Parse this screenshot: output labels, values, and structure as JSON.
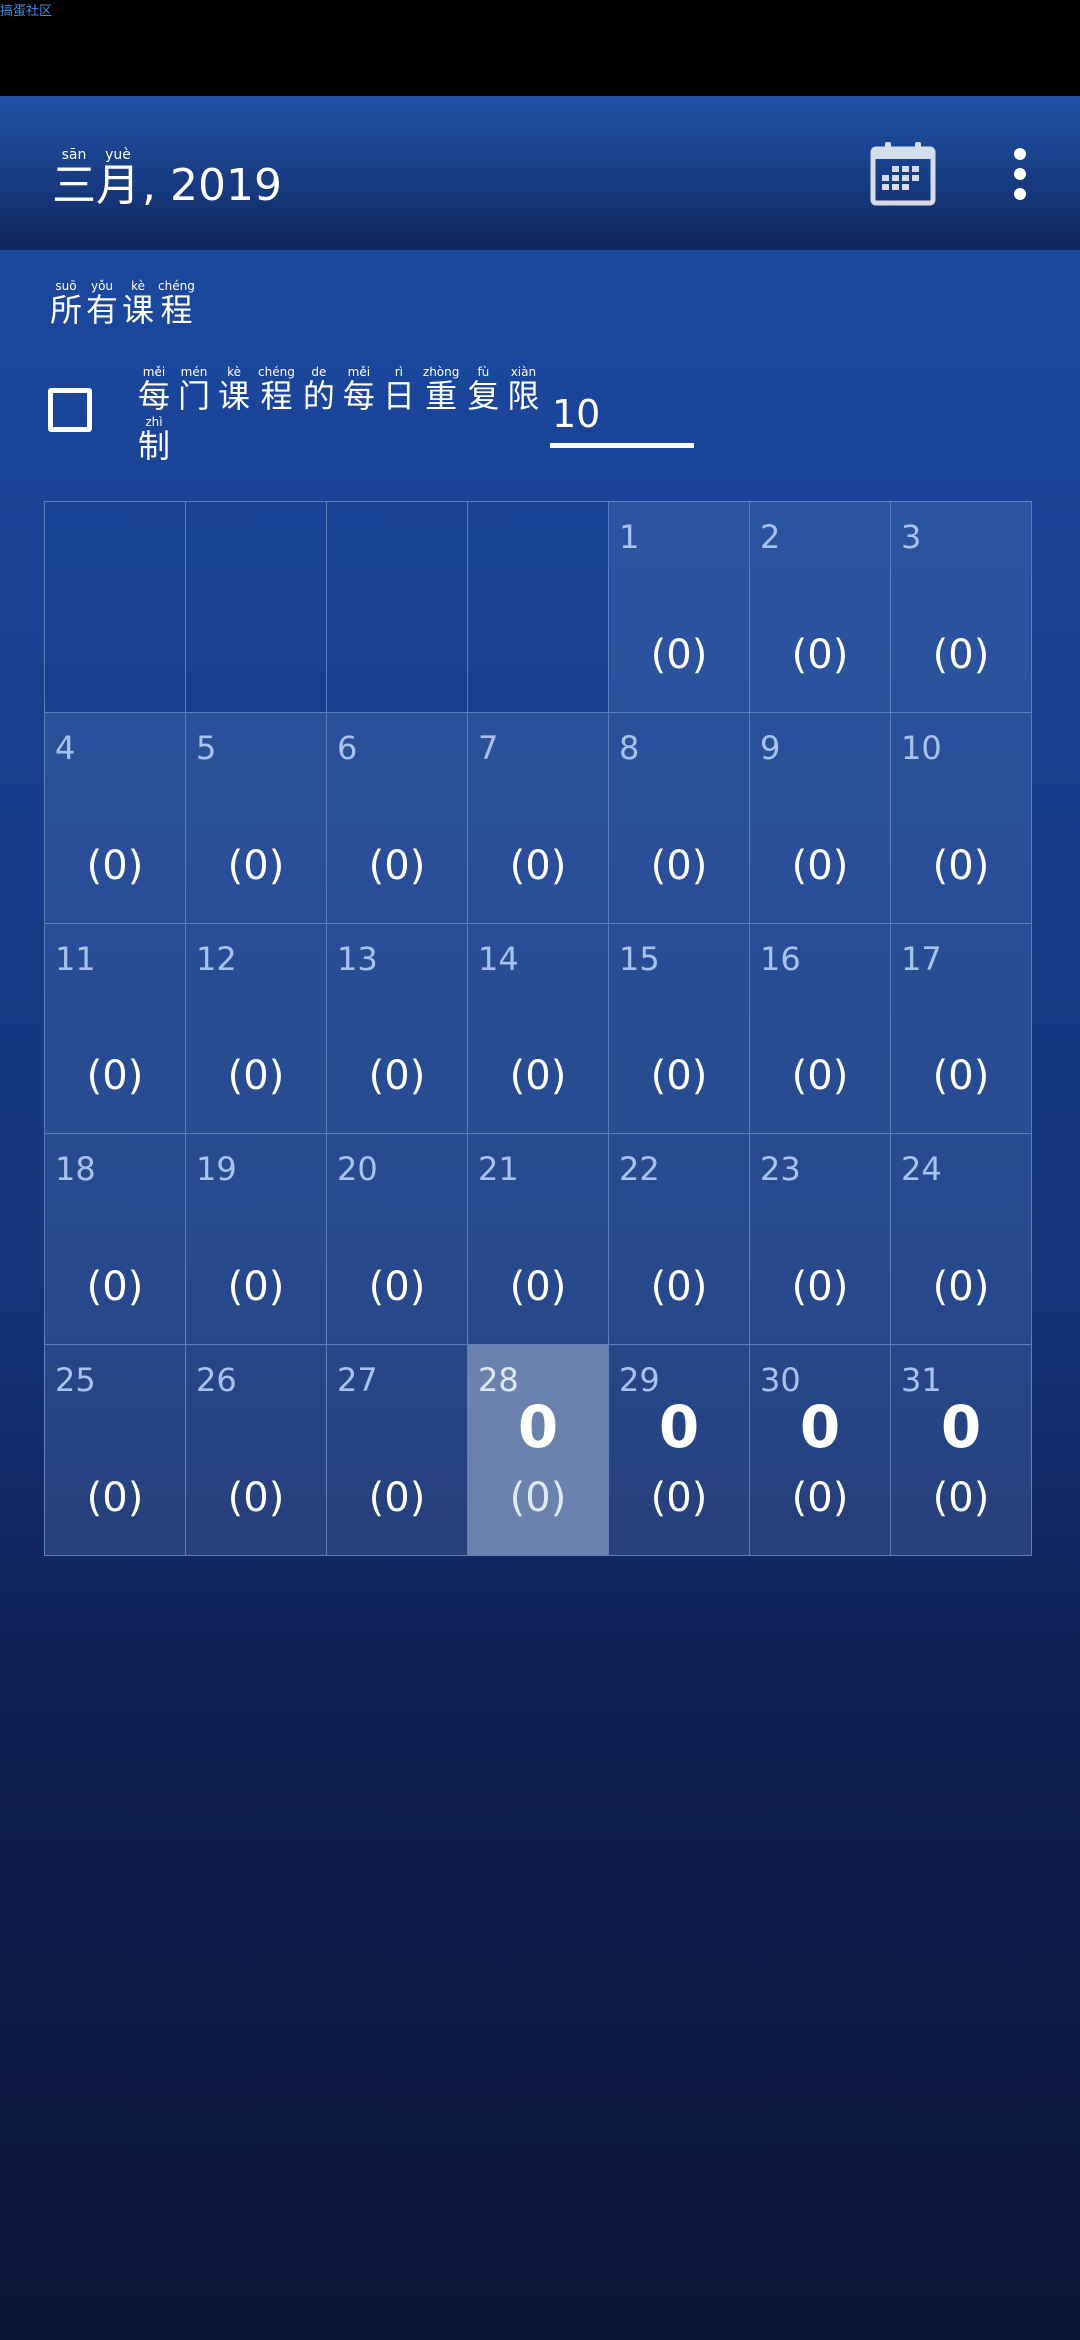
{
  "status_bar": {
    "watermark": "搞蛋社区"
  },
  "header": {
    "month": [
      {
        "char": "三",
        "pinyin": "sān"
      },
      {
        "char": "月",
        "pinyin": "yuè"
      }
    ],
    "year_suffix": ", 2019",
    "calendar_icon": "calendar-icon",
    "more_icon": "more-vert-icon"
  },
  "filter": {
    "all_courses": [
      {
        "char": "所",
        "pinyin": "suō"
      },
      {
        "char": "有",
        "pinyin": "yǒu"
      },
      {
        "char": "课",
        "pinyin": "kè"
      },
      {
        "char": "程",
        "pinyin": "chéng"
      }
    ]
  },
  "limit": {
    "checked": false,
    "label_line1": [
      {
        "char": "每",
        "pinyin": "měi"
      },
      {
        "char": "门",
        "pinyin": "mén"
      },
      {
        "char": "课",
        "pinyin": "kè"
      },
      {
        "char": "程",
        "pinyin": "chéng"
      },
      {
        "char": "的",
        "pinyin": "de"
      },
      {
        "char": "每",
        "pinyin": "měi"
      },
      {
        "char": "日",
        "pinyin": "rì"
      },
      {
        "char": "重",
        "pinyin": "zhòng"
      },
      {
        "char": "复",
        "pinyin": "fù"
      },
      {
        "char": "限",
        "pinyin": "xiàn"
      }
    ],
    "label_line2": [
      {
        "char": "制",
        "pinyin": "zhì"
      }
    ],
    "value": "10"
  },
  "calendar": {
    "leading_empty": 4,
    "today": 28,
    "days": [
      {
        "day": "1",
        "count": "(0)",
        "big": ""
      },
      {
        "day": "2",
        "count": "(0)",
        "big": ""
      },
      {
        "day": "3",
        "count": "(0)",
        "big": ""
      },
      {
        "day": "4",
        "count": "(0)",
        "big": ""
      },
      {
        "day": "5",
        "count": "(0)",
        "big": ""
      },
      {
        "day": "6",
        "count": "(0)",
        "big": ""
      },
      {
        "day": "7",
        "count": "(0)",
        "big": ""
      },
      {
        "day": "8",
        "count": "(0)",
        "big": ""
      },
      {
        "day": "9",
        "count": "(0)",
        "big": ""
      },
      {
        "day": "10",
        "count": "(0)",
        "big": ""
      },
      {
        "day": "11",
        "count": "(0)",
        "big": ""
      },
      {
        "day": "12",
        "count": "(0)",
        "big": ""
      },
      {
        "day": "13",
        "count": "(0)",
        "big": ""
      },
      {
        "day": "14",
        "count": "(0)",
        "big": ""
      },
      {
        "day": "15",
        "count": "(0)",
        "big": ""
      },
      {
        "day": "16",
        "count": "(0)",
        "big": ""
      },
      {
        "day": "17",
        "count": "(0)",
        "big": ""
      },
      {
        "day": "18",
        "count": "(0)",
        "big": ""
      },
      {
        "day": "19",
        "count": "(0)",
        "big": ""
      },
      {
        "day": "20",
        "count": "(0)",
        "big": ""
      },
      {
        "day": "21",
        "count": "(0)",
        "big": ""
      },
      {
        "day": "22",
        "count": "(0)",
        "big": ""
      },
      {
        "day": "23",
        "count": "(0)",
        "big": ""
      },
      {
        "day": "24",
        "count": "(0)",
        "big": ""
      },
      {
        "day": "25",
        "count": "(0)",
        "big": ""
      },
      {
        "day": "26",
        "count": "(0)",
        "big": ""
      },
      {
        "day": "27",
        "count": "(0)",
        "big": ""
      },
      {
        "day": "28",
        "count": "(0)",
        "big": "0"
      },
      {
        "day": "29",
        "count": "(0)",
        "big": "0"
      },
      {
        "day": "30",
        "count": "(0)",
        "big": "0"
      },
      {
        "day": "31",
        "count": "(0)",
        "big": "0"
      }
    ]
  }
}
